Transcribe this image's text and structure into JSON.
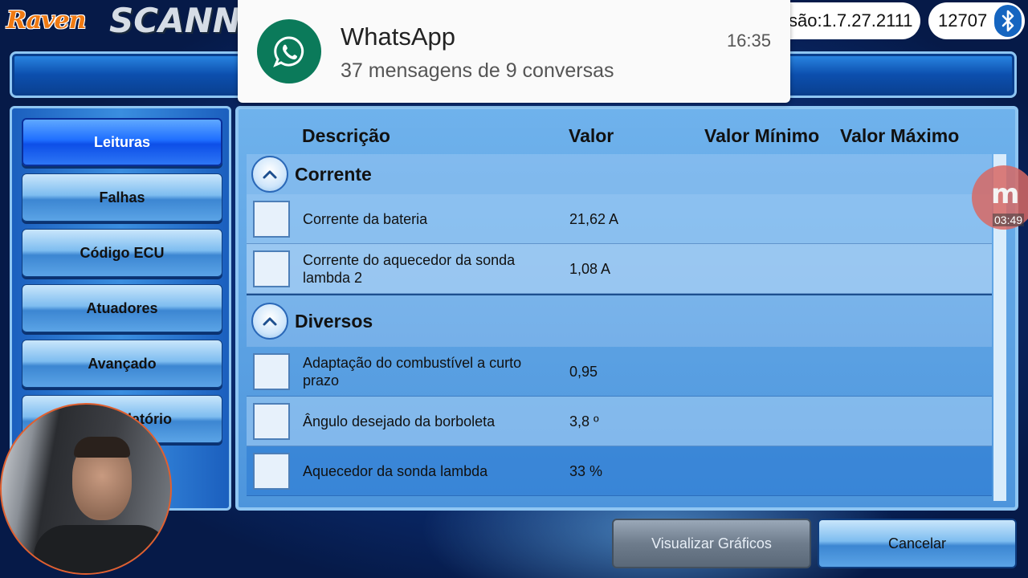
{
  "header": {
    "logo_brand": "Raven",
    "logo_product": "SCANN",
    "version_text": "são:1.7.27.2111",
    "device_id": "12707",
    "status_icon": "bluetooth-icon"
  },
  "sidebar": {
    "items": [
      {
        "label": "Leituras",
        "active": true
      },
      {
        "label": "Falhas",
        "active": false
      },
      {
        "label": "Código ECU",
        "active": false
      },
      {
        "label": "Atuadores",
        "active": false
      },
      {
        "label": "Avançado",
        "active": false
      },
      {
        "label": "latório",
        "active": false
      }
    ]
  },
  "table": {
    "columns": [
      "Descrição",
      "Valor",
      "Valor Mínimo",
      "Valor Máximo"
    ],
    "groups": [
      {
        "title": "Corrente",
        "rows": [
          {
            "description": "Corrente da bateria",
            "value": "21,62 A"
          },
          {
            "description": "Corrente do aquecedor da sonda lambda 2",
            "value": "1,08 A"
          }
        ]
      },
      {
        "title": "Diversos",
        "rows": [
          {
            "description": "Adaptação do combustível a curto prazo",
            "value": "0,95"
          },
          {
            "description": "Ângulo desejado da borboleta",
            "value": "3,8 º"
          },
          {
            "description": "Aquecedor da sonda lambda",
            "value": "33 %"
          }
        ]
      }
    ]
  },
  "buttons": {
    "graphs_label": "Visualizar Gráficos",
    "cancel_label": "Cancelar"
  },
  "notification": {
    "app": "WhatsApp",
    "body": "37 mensagens de 9 conversas",
    "time": "16:35",
    "icon": "whatsapp-icon"
  },
  "recorder": {
    "timer": "03:49"
  },
  "colors": {
    "accent_blue": "#1f6fff",
    "panel_blue": "#6fb2ec",
    "whatsapp_green": "#0b7a5a",
    "brand_orange": "#f07a12"
  }
}
